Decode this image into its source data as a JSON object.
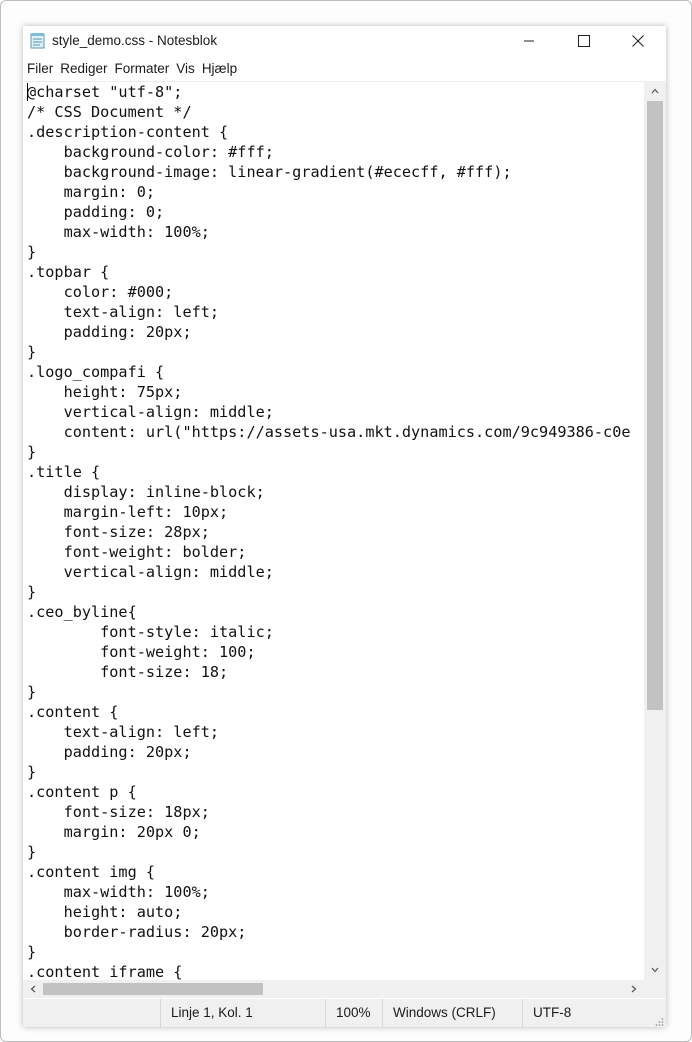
{
  "window": {
    "title": "style_demo.css - Notesblok",
    "icon": "notepad-icon"
  },
  "menu": [
    "Filer",
    "Rediger",
    "Formater",
    "Vis",
    "Hjælp"
  ],
  "editor": {
    "content": "@charset \"utf-8\";\n/* CSS Document */\n.description-content {\n    background-color: #fff;\n    background-image: linear-gradient(#ececff, #fff);\n    margin: 0;\n    padding: 0;\n    max-width: 100%;\n}\n.topbar {\n    color: #000;\n    text-align: left;\n    padding: 20px;\n}\n.logo_compafi {\n    height: 75px;\n    vertical-align: middle;\n    content: url(\"https://assets-usa.mkt.dynamics.com/9c949386-c0e\n}\n.title {\n    display: inline-block;\n    margin-left: 10px;\n    font-size: 28px;\n    font-weight: bolder;\n    vertical-align: middle;\n}\n.ceo_byline{\n        font-style: italic;\n        font-weight: 100;\n        font-size: 18;\n}\n.content {\n    text-align: left;\n    padding: 20px;\n}\n.content p {\n    font-size: 18px;\n    margin: 20px 0;\n}\n.content img {\n    max-width: 100%;\n    height: auto;\n    border-radius: 20px;\n}\n.content iframe {"
  },
  "status": {
    "position": "Linje 1, Kol. 1",
    "zoom": "100%",
    "line_endings": "Windows (CRLF)",
    "encoding": "UTF-8"
  },
  "colors": {
    "chrome": "#f0f0f0",
    "scroll_thumb": "#c2c2c2",
    "text": "#111111"
  }
}
